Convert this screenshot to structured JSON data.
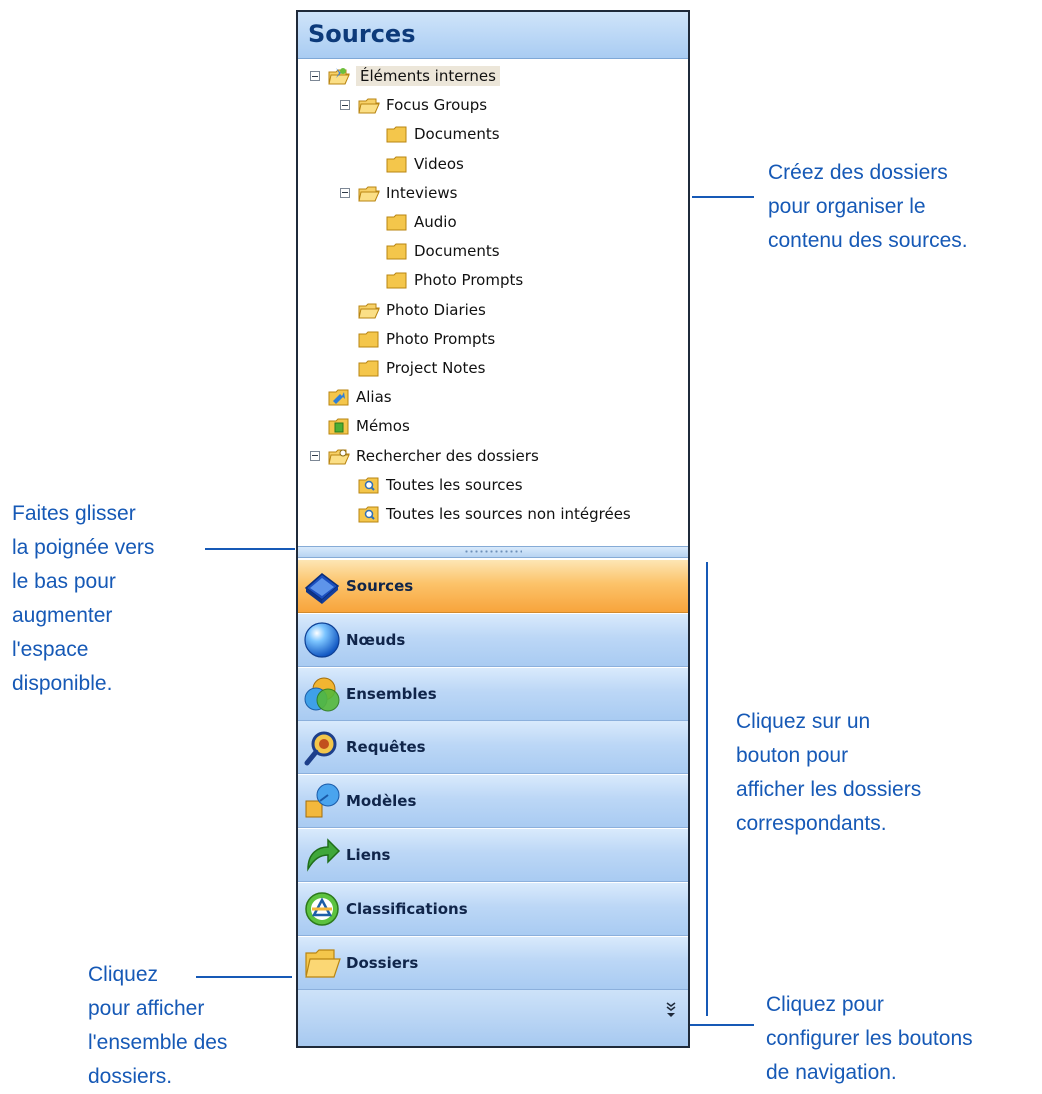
{
  "panel": {
    "title": "Sources",
    "tree": [
      {
        "label": "Éléments internes",
        "level": 0,
        "expander": true,
        "icon": "folder-special-icon",
        "selected": true
      },
      {
        "label": "Focus Groups",
        "level": 1,
        "expander": true,
        "icon": "folder-open-icon"
      },
      {
        "label": "Documents",
        "level": 2,
        "expander": false,
        "icon": "folder-icon"
      },
      {
        "label": "Videos",
        "level": 2,
        "expander": false,
        "icon": "folder-icon"
      },
      {
        "label": "Inteviews",
        "level": 1,
        "expander": true,
        "icon": "folder-open-icon"
      },
      {
        "label": "Audio",
        "level": 2,
        "expander": false,
        "icon": "folder-icon"
      },
      {
        "label": "Documents",
        "level": 2,
        "expander": false,
        "icon": "folder-icon"
      },
      {
        "label": "Photo  Prompts",
        "level": 2,
        "expander": false,
        "icon": "folder-icon"
      },
      {
        "label": "Photo Diaries",
        "level": 1,
        "expander": false,
        "icon": "folder-open-icon"
      },
      {
        "label": "Photo Prompts",
        "level": 1,
        "expander": false,
        "icon": "folder-icon"
      },
      {
        "label": "Project Notes",
        "level": 1,
        "expander": false,
        "icon": "folder-icon"
      },
      {
        "label": "Alias",
        "level": 0,
        "expander": false,
        "icon": "folder-alias-icon"
      },
      {
        "label": "Mémos",
        "level": 0,
        "expander": false,
        "icon": "folder-memo-icon"
      },
      {
        "label": "Rechercher des dossiers",
        "level": 0,
        "expander": true,
        "icon": "folder-search-icon"
      },
      {
        "label": "Toutes les sources",
        "level": 1,
        "expander": false,
        "icon": "search-folder-icon"
      },
      {
        "label": "Toutes les sources non intégrées",
        "level": 1,
        "expander": false,
        "icon": "search-folder-icon"
      }
    ],
    "nav_buttons": [
      {
        "label": "Sources",
        "icon": "sources-book-icon",
        "active": true
      },
      {
        "label": "Nœuds",
        "icon": "nodes-sphere-icon",
        "active": false
      },
      {
        "label": "Ensembles",
        "icon": "sets-icon",
        "active": false
      },
      {
        "label": "Requêtes",
        "icon": "queries-magnifier-icon",
        "active": false
      },
      {
        "label": "Modèles",
        "icon": "models-shapes-icon",
        "active": false
      },
      {
        "label": "Liens",
        "icon": "links-arrow-icon",
        "active": false
      },
      {
        "label": "Classifications",
        "icon": "classifications-icon",
        "active": false
      },
      {
        "label": "Dossiers",
        "icon": "folders-icon",
        "active": false
      }
    ]
  },
  "annotations": {
    "folders_note": [
      "Créez des dossiers",
      "pour organiser le",
      "contenu des sources."
    ],
    "drag_note": [
      "Faites glisser",
      "la poignée vers",
      "le bas pour",
      "augmenter",
      "l'espace",
      "disponible."
    ],
    "click_button_note": [
      "Cliquez sur un",
      "bouton pour",
      "afficher les dossiers",
      "correspondants."
    ],
    "click_all_note": [
      "Cliquez",
      "pour afficher",
      "l'ensemble des",
      "dossiers."
    ],
    "configure_note": [
      "Cliquez pour",
      "configurer les boutons",
      "de navigation."
    ]
  },
  "colors": {
    "annotation_blue": "#1659b6",
    "active_orange": "#f7a43c",
    "nav_blue": "#bcd7f6"
  }
}
